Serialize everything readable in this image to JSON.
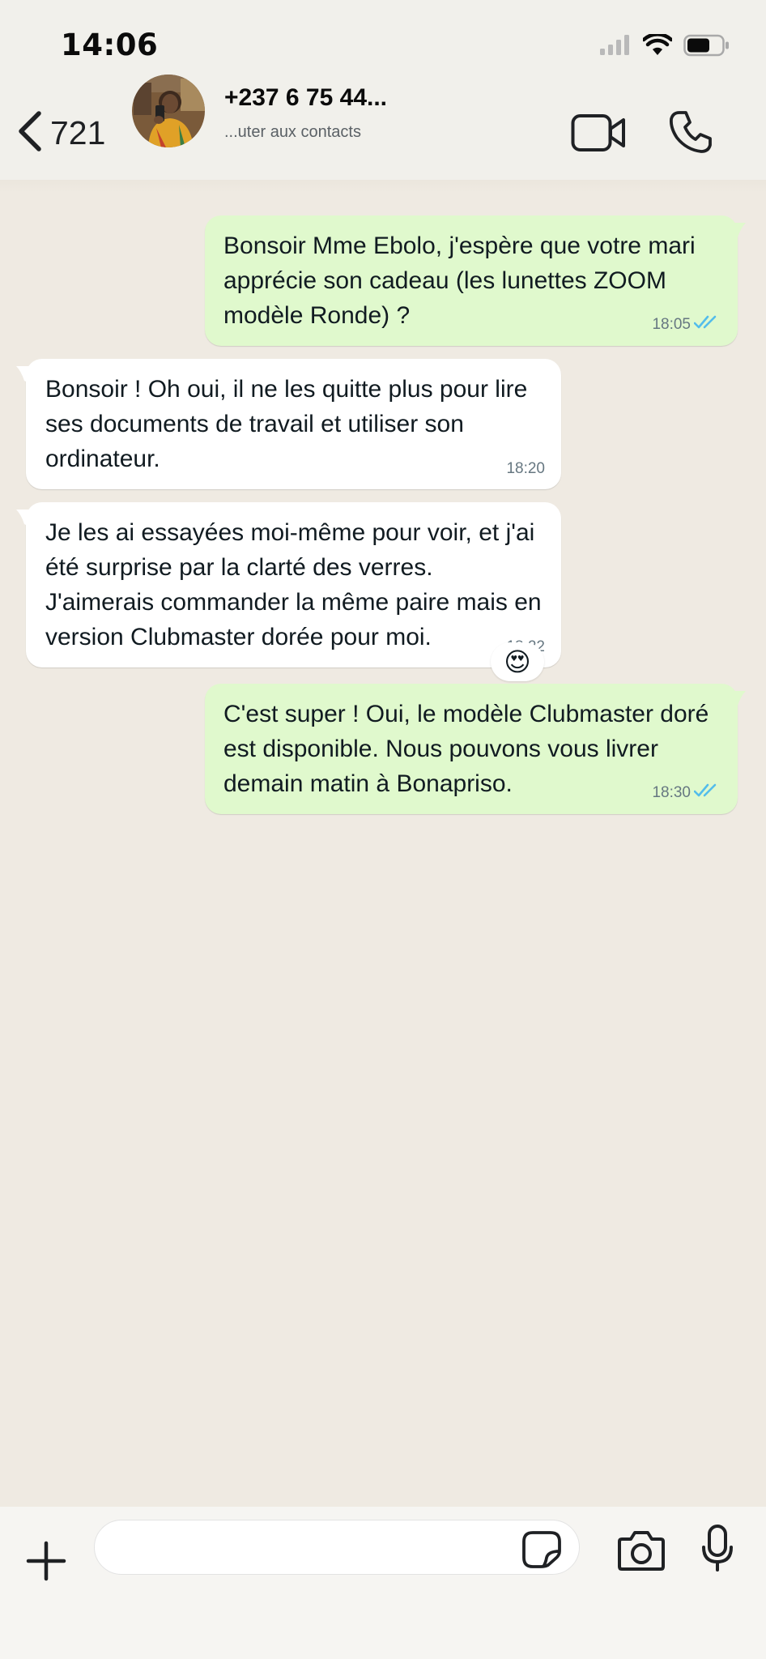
{
  "status_bar": {
    "time": "14:06"
  },
  "header": {
    "back_count": "721",
    "contact_name": "+237 6 75 44...",
    "contact_subtitle": "...uter aux contacts"
  },
  "messages": [
    {
      "direction": "outgoing",
      "text": "Bonsoir Mme Ebolo, j'espère que votre mari apprécie son cadeau (les lunettes ZOOM modèle Ronde) ?",
      "time": "18:05",
      "status": "read"
    },
    {
      "direction": "incoming",
      "text": "Bonsoir ! Oh oui, il ne les quitte plus pour lire ses documents de travail et utiliser son ordinateur.",
      "time": "18:20"
    },
    {
      "direction": "incoming",
      "text": "Je les ai essayées moi-même pour voir, et j'ai été surprise par la clarté des verres. J'aimerais commander la même paire mais en version Clubmaster dorée pour moi.",
      "time": "18:22",
      "reaction": "😍"
    },
    {
      "direction": "outgoing",
      "text": "C'est super ! Oui, le modèle Clubmaster doré est disponible. Nous pouvons vous livrer demain matin à Bonapriso.",
      "time": "18:30",
      "status": "read"
    }
  ],
  "composer": {
    "placeholder": ""
  },
  "colors": {
    "chat_background": "#efeae2",
    "outgoing_bubble": "#e0f9cd",
    "incoming_bubble": "#ffffff",
    "read_ticks": "#53bdeb",
    "header_background": "#f1f0eb"
  },
  "icons": {
    "status_bar": [
      "signal-icon",
      "wifi-icon",
      "battery-icon"
    ],
    "header": [
      "chevron-left-icon",
      "video-camera-icon",
      "phone-icon"
    ],
    "composer": [
      "plus-icon",
      "sticker-icon",
      "camera-icon",
      "microphone-icon"
    ]
  }
}
